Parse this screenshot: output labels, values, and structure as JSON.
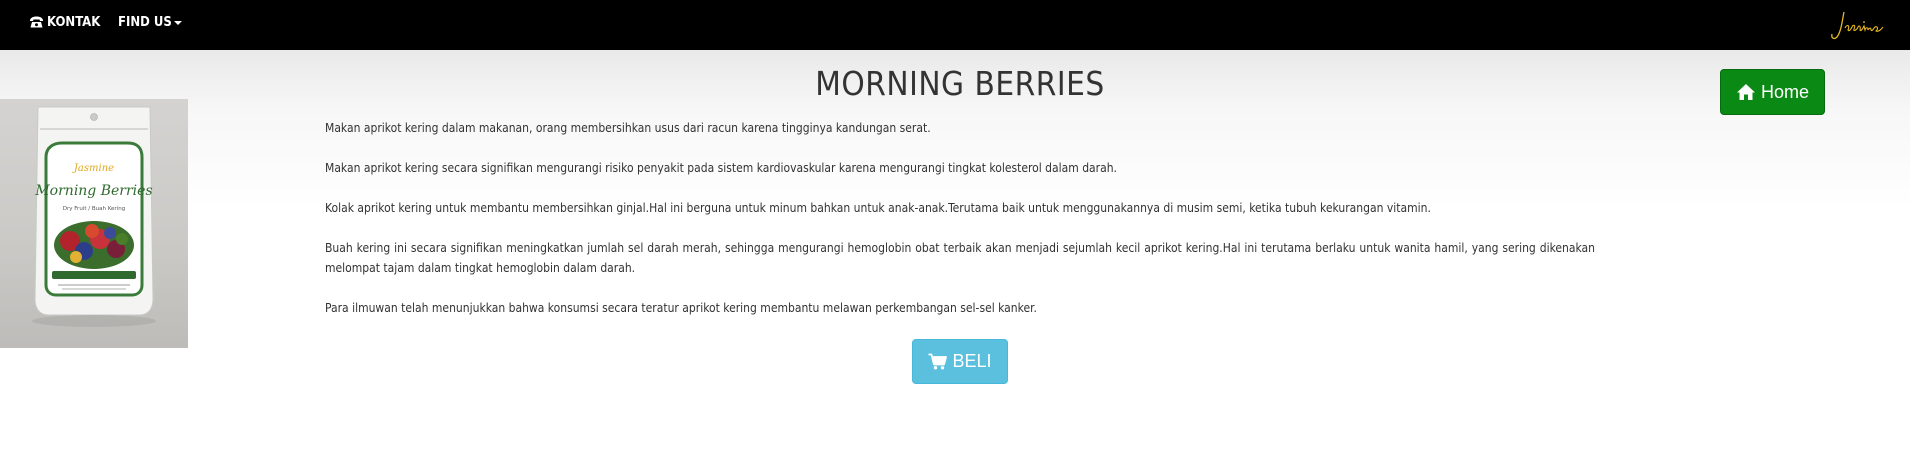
{
  "navbar": {
    "kontak_label": "KONTAK",
    "findus_label": "FIND US",
    "brand": "Jasmine",
    "colors": {
      "background": "#000000",
      "text": "#ffffff",
      "brand": "#e8b923"
    }
  },
  "product": {
    "title": "MORNING BERRIES",
    "image_texts": {
      "brand": "Jasmine",
      "name": "Morning Berries",
      "sub": "Dry Fruit / Buah Kering"
    },
    "paragraphs": [
      "Makan aprikot kering dalam makanan, orang membersihkan usus dari racun karena tingginya kandungan serat.",
      "Makan aprikot kering secara signifikan mengurangi risiko penyakit pada sistem kardiovaskular karena mengurangi tingkat kolesterol dalam darah.",
      "Kolak aprikot kering untuk membantu membersihkan ginjal.Hal ini berguna untuk minum bahkan untuk anak-anak.Terutama baik untuk menggunakannya di musim semi, ketika tubuh kekurangan vitamin.",
      "Buah kering ini secara signifikan meningkatkan jumlah sel darah merah, sehingga mengurangi hemoglobin obat terbaik akan menjadi sejumlah kecil aprikot kering.Hal ini terutama berlaku untuk wanita hamil, yang sering dikenakan melompat tajam dalam tingkat hemoglobin dalam darah.",
      "Para ilmuwan telah menunjukkan bahwa konsumsi secara teratur aprikot kering membantu melawan perkembangan sel-sel kanker."
    ]
  },
  "buttons": {
    "home_label": "Home",
    "beli_label": "BELI",
    "home_color": "#0a8a14",
    "beli_color": "#5bc0de"
  },
  "icons": {
    "kontak": "phone-icon",
    "findus": "caret-down-icon",
    "home": "home-icon",
    "beli": "cart-icon"
  }
}
